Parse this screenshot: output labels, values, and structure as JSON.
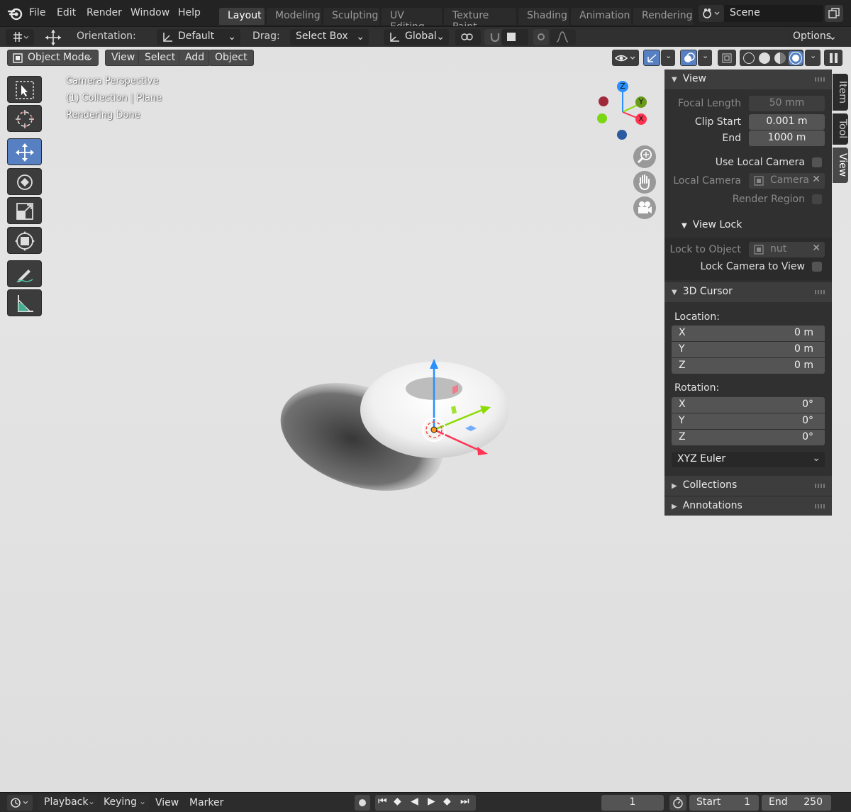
{
  "menu": {
    "items": [
      "File",
      "Edit",
      "Render",
      "Window",
      "Help"
    ]
  },
  "workspaces": [
    {
      "label": "Layout",
      "active": true
    },
    {
      "label": "Modeling",
      "active": false
    },
    {
      "label": "Sculpting",
      "active": false
    },
    {
      "label": "UV Editing",
      "active": false
    },
    {
      "label": "Texture Paint",
      "active": false
    },
    {
      "label": "Shading",
      "active": false
    },
    {
      "label": "Animation",
      "active": false
    },
    {
      "label": "Rendering",
      "active": false
    }
  ],
  "scene": {
    "name": "Scene"
  },
  "tool_header": {
    "orientation_label": "Orientation:",
    "orientation_value": "Default",
    "drag_label": "Drag:",
    "drag_value": "Select Box",
    "transform_orientation": "Global",
    "options_label": "Options"
  },
  "viewport_header": {
    "mode": "Object Mode",
    "menus": [
      "View",
      "Select",
      "Add",
      "Object"
    ]
  },
  "overlay": {
    "line1": "Camera Perspective",
    "line2": "(1) Collection | Plane",
    "line3": "Rendering Done"
  },
  "gizmo": {
    "z": "Z",
    "y": "Y",
    "x": "X",
    "colors": {
      "x": "#ff3352",
      "y": "#8bdc00",
      "z": "#2890ff"
    }
  },
  "sidebar": {
    "tabs": [
      "Item",
      "Tool",
      "View"
    ],
    "active_tab": "View",
    "view_panel": {
      "title": "View",
      "focal_length_label": "Focal Length",
      "focal_length_value": "50 mm",
      "clip_start_label": "Clip Start",
      "clip_start_value": "0.001 m",
      "clip_end_label": "End",
      "clip_end_value": "1000 m",
      "use_local_camera_label": "Use Local Camera",
      "local_camera_label": "Local Camera",
      "local_camera_value": "Camera",
      "render_region_label": "Render Region"
    },
    "view_lock": {
      "title": "View Lock",
      "lock_to_object_label": "Lock to Object",
      "lock_to_object_value": "nut",
      "lock_camera_label": "Lock Camera to View"
    },
    "cursor_panel": {
      "title": "3D Cursor",
      "location_label": "Location:",
      "location": [
        {
          "axis": "X",
          "value": "0 m"
        },
        {
          "axis": "Y",
          "value": "0 m"
        },
        {
          "axis": "Z",
          "value": "0 m"
        }
      ],
      "rotation_label": "Rotation:",
      "rotation": [
        {
          "axis": "X",
          "value": "0°"
        },
        {
          "axis": "Y",
          "value": "0°"
        },
        {
          "axis": "Z",
          "value": "0°"
        }
      ],
      "rotation_mode": "XYZ Euler"
    },
    "collapsed_panels": [
      "Collections",
      "Annotations"
    ]
  },
  "timeline": {
    "menus": [
      "Playback",
      "Keying",
      "View",
      "Marker"
    ],
    "current_frame": "1",
    "start_label": "Start",
    "start_value": "1",
    "end_label": "End",
    "end_value": "250"
  },
  "colors": {
    "accent": "#5680c2",
    "panel_bg": "#303030",
    "header_bg": "#3d3d3d",
    "viewport_bg": "#e2e2e2"
  }
}
